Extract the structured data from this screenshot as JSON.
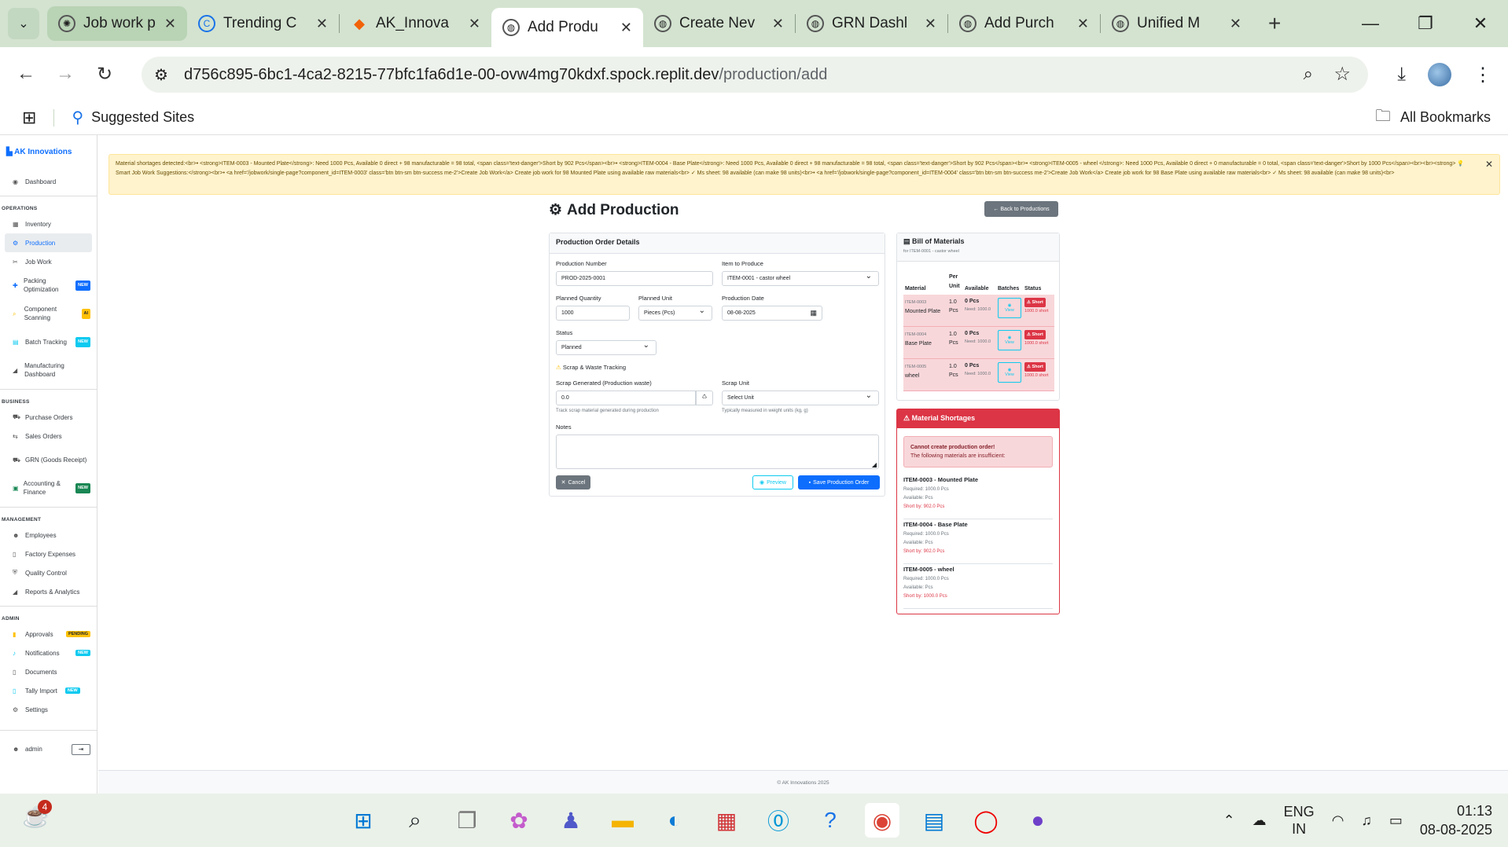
{
  "browser": {
    "tabs": [
      {
        "title": "Job work p"
      },
      {
        "title": "Trending C"
      },
      {
        "title": "AK_Innova"
      },
      {
        "title": "Add Produ"
      },
      {
        "title": "Create Nev"
      },
      {
        "title": "GRN Dashl"
      },
      {
        "title": "Add Purch"
      },
      {
        "title": "Unified M"
      }
    ],
    "url_host": "d756c895-6bc1-4ca2-8215-77bfc1fa6d1e-00-ovw4mg70kdxf.spock.replit.dev",
    "url_path": "/production/add",
    "bookmark_suggested": "Suggested Sites",
    "bookmark_all": "All Bookmarks"
  },
  "sidebar": {
    "brand": "AK Innovations",
    "dashboard": "Dashboard",
    "sections": {
      "operations": "OPERATIONS",
      "business": "BUSINESS",
      "management": "MANAGEMENT",
      "admin": "ADMIN"
    },
    "operations": [
      {
        "label": "Inventory"
      },
      {
        "label": "Production"
      },
      {
        "label": "Job Work"
      },
      {
        "label": "Packing Optimization",
        "badge": "NEW"
      },
      {
        "label": "Component Scanning",
        "badge": "AI"
      },
      {
        "label": "Batch Tracking",
        "badge": "NEW"
      },
      {
        "label": "Manufacturing Dashboard"
      }
    ],
    "business": [
      {
        "label": "Purchase Orders"
      },
      {
        "label": "Sales Orders"
      },
      {
        "label": "GRN (Goods Receipt)"
      },
      {
        "label": "Accounting & Finance",
        "badge": "NEW"
      }
    ],
    "management": [
      {
        "label": "Employees"
      },
      {
        "label": "Factory Expenses"
      },
      {
        "label": "Quality Control"
      },
      {
        "label": "Reports & Analytics"
      }
    ],
    "admin": [
      {
        "label": "Approvals",
        "badge": "PENDING"
      },
      {
        "label": "Notifications",
        "badge": "NEW"
      },
      {
        "label": "Documents"
      },
      {
        "label": "Tally Import",
        "badge": "NEW"
      },
      {
        "label": "Settings"
      }
    ],
    "user": "admin"
  },
  "alert": {
    "text": "Material shortages detected:<br>• <strong>ITEM-0003 - Mounted Plate</strong>: Need 1000 Pcs, Available 0 direct + 98 manufacturable = 98 total, <span class='text-danger'>Short by 902 Pcs</span><br>• <strong>ITEM-0004 - Base Plate</strong>: Need 1000 Pcs, Available 0 direct + 98 manufacturable = 98 total, <span class='text-danger'>Short by 902 Pcs</span><br>• <strong>ITEM-0005 - wheel </strong>: Need 1000 Pcs, Available 0 direct + 0 manufacturable = 0 total, <span class='text-danger'>Short by 1000 Pcs</span><br><br><strong> 💡 Smart Job Work Suggestions:</strong><br>• <a href='/jobwork/single-page?component_id=ITEM-0003' class='btn btn-sm btn-success me-2'>Create Job Work</a> Create job work for 98 Mounted Plate using available raw materials<br> ✓ Ms sheet: 98 available (can make 98 units)<br>• <a href='/jobwork/single-page?component_id=ITEM-0004' class='btn btn-sm btn-success me-2'>Create Job Work</a> Create job work for 98 Base Plate using available raw materials<br> ✓ Ms sheet: 98 available (can make 98 units)<br>"
  },
  "page": {
    "title": "Add Production",
    "back_button": "Back to Productions"
  },
  "form": {
    "header": "Production Order Details",
    "production_number_label": "Production Number",
    "production_number": "PROD-2025-0001",
    "item_label": "Item to Produce",
    "item_value": "ITEM-0001 - castor wheel",
    "planned_qty_label": "Planned Quantity",
    "planned_qty": "1000",
    "planned_unit_label": "Planned Unit",
    "planned_unit": "Pieces (Pcs)",
    "production_date_label": "Production Date",
    "production_date": "08-08-2025",
    "status_label": "Status",
    "status_value": "Planned",
    "scrap_section": "Scrap & Waste Tracking",
    "scrap_generated_label": "Scrap Generated (Production waste)",
    "scrap_generated": "0.0",
    "scrap_help": "Track scrap material generated during production",
    "scrap_unit_label": "Scrap Unit",
    "scrap_unit": "Select Unit",
    "scrap_unit_help": "Typically measured in weight units (kg, g)",
    "notes_label": "Notes",
    "cancel": "Cancel",
    "preview": "Preview",
    "save": "Save Production Order"
  },
  "bom": {
    "header": "Bill of Materials",
    "subtitle": "for ITEM-0001 - castor wheel",
    "columns": [
      "Material",
      "Per Unit",
      "Available",
      "Batches",
      "Status"
    ],
    "rows": [
      {
        "code": "ITEM-0003",
        "name": "Mounted Plate",
        "per_unit": "1.0 Pcs",
        "available": "0 Pcs",
        "need": "Need: 1000.0",
        "view": "View",
        "status": "Short",
        "short": "1000.0 short"
      },
      {
        "code": "ITEM-0004",
        "name": "Base Plate",
        "per_unit": "1.0 Pcs",
        "available": "0 Pcs",
        "need": "Need: 1000.0",
        "view": "View",
        "status": "Short",
        "short": "1000.0 short"
      },
      {
        "code": "ITEM-0005",
        "name": "wheel",
        "per_unit": "1.0 Pcs",
        "available": "0 Pcs",
        "need": "Need: 1000.0",
        "view": "View",
        "status": "Short",
        "short": "1000.0 short"
      }
    ]
  },
  "shortages": {
    "header": "Material Shortages",
    "cannot_title": "Cannot create production order!",
    "cannot_text": "The following materials are insufficient:",
    "items": [
      {
        "title": "ITEM-0003 - Mounted Plate",
        "required": "Required: 1000.0 Pcs",
        "available": "Available: Pcs",
        "short": "Short by: 902.0 Pcs"
      },
      {
        "title": "ITEM-0004 - Base Plate",
        "required": "Required: 1000.0 Pcs",
        "available": "Available: Pcs",
        "short": "Short by: 902.0 Pcs"
      },
      {
        "title": "ITEM-0005 - wheel",
        "required": "Required: 1000.0 Pcs",
        "available": "Available: Pcs",
        "short": "Short by: 1000.0 Pcs"
      }
    ]
  },
  "footer": "© AK Innovations 2025",
  "taskbar": {
    "notif_count": "4",
    "lang1": "ENG",
    "lang2": "IN",
    "time": "01:13",
    "date": "08-08-2025"
  },
  "colors": {
    "primary": "#0d6efd",
    "danger": "#dc3545",
    "warning_bg": "#fff3cd",
    "secondary": "#6c757d"
  }
}
